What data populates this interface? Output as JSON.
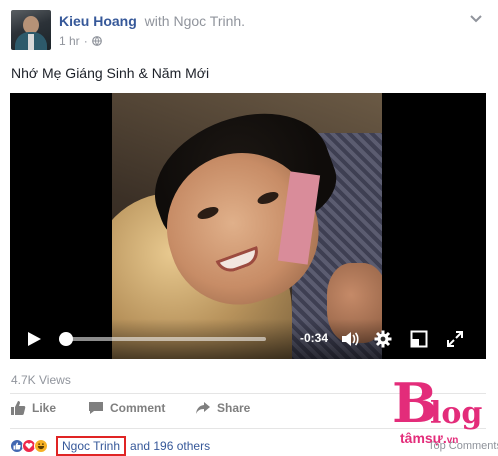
{
  "post": {
    "author": "Kieu Hoang",
    "with_word": "with",
    "tagged": "Ngoc Trinh.",
    "time": "1 hr",
    "text": "Nhớ Mẹ Giáng Sinh & Năm Mới"
  },
  "video": {
    "time_remaining": "-0:34",
    "progress": 0.02
  },
  "stats": {
    "views": "4.7K Views"
  },
  "actions": {
    "like": "Like",
    "comment": "Comment",
    "share": "Share"
  },
  "reactions": {
    "icons": [
      "like-icon",
      "love-icon",
      "haha-icon"
    ],
    "first_reactor": "Ngoc Trinh",
    "others": "and 196 others"
  },
  "comments": {
    "sort_label": "Top Comments"
  },
  "watermark": {
    "letters_b": "B",
    "letters_log": "log",
    "site": "tâmsự",
    "tld": "vn"
  },
  "colors": {
    "link": "#365899",
    "muted": "#90949c",
    "highlight_box": "#e02424",
    "watermark": "#e32c7a"
  }
}
